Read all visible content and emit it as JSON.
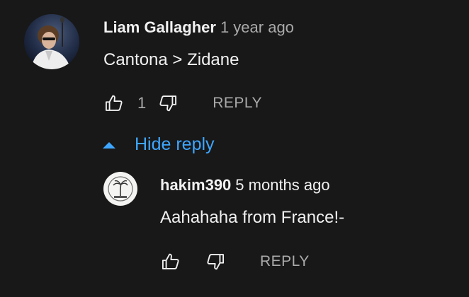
{
  "comment": {
    "author": "Liam Gallagher",
    "timestamp": "1 year ago",
    "text": "Cantona > Zidane",
    "like_count": "1",
    "reply_label": "REPLY",
    "like_icon": "thumbs-up-icon",
    "dislike_icon": "thumbs-down-icon"
  },
  "replies_toggle": {
    "label": "Hide reply",
    "icon": "caret-up-icon",
    "color": "#3ea6ff"
  },
  "reply": {
    "author": "hakim390",
    "timestamp": "5 months ago",
    "text": "Aahahaha from France!-",
    "reply_label": "REPLY",
    "like_icon": "thumbs-up-icon",
    "dislike_icon": "thumbs-down-icon"
  },
  "colors": {
    "background": "#181818",
    "text_primary": "#f1f1f1",
    "text_secondary": "#aaaaaa",
    "link": "#3ea6ff"
  }
}
